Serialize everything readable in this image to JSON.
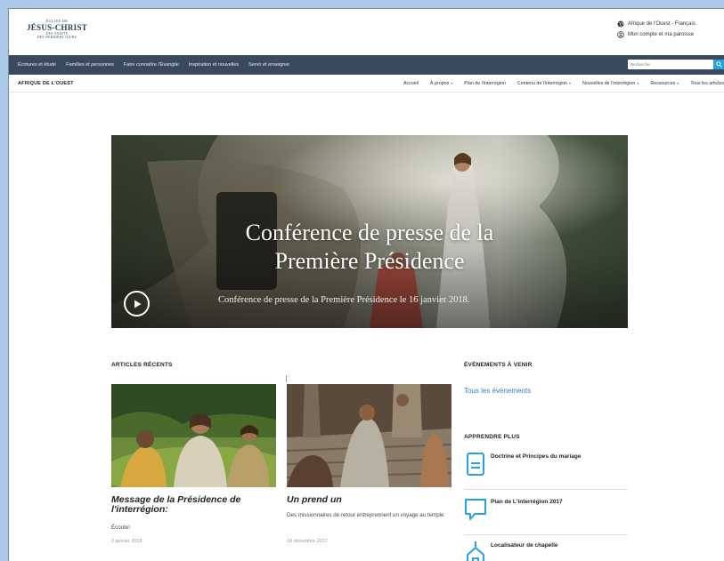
{
  "header": {
    "logo": {
      "line1": "ÉGLISE DE",
      "line2": "JÉSUS-CHRIST",
      "line3": "DES SAINTS",
      "line4": "DES DERNIERS JOURS"
    },
    "region_language": "Afrique de l'Ouest - Français",
    "account": "Mon compte et ma paroisse"
  },
  "main_nav": {
    "items": [
      "Écritures et étude",
      "Familles et personnes",
      "Faire connaître l'Évangile",
      "Inspiration et nouvelles",
      "Servir et enseigner"
    ],
    "search_placeholder": "Recherche"
  },
  "sub_nav": {
    "region": "AFRIQUE DE L'OUEST",
    "links": [
      {
        "label": "Accueil",
        "dropdown": false
      },
      {
        "label": "À propos",
        "dropdown": true
      },
      {
        "label": "Plan de l'interrégion",
        "dropdown": false
      },
      {
        "label": "Contenu de l'interrégion",
        "dropdown": true
      },
      {
        "label": "Nouvelles de l'interrégion",
        "dropdown": true
      },
      {
        "label": "Ressources",
        "dropdown": true
      },
      {
        "label": "Tous les articles",
        "dropdown": false
      }
    ]
  },
  "hero": {
    "title": "Conférence de presse de la Première Présidence",
    "subtitle": "Conférence de presse de la Première Présidence le 16 janvier 2018."
  },
  "articles": {
    "section_title": "ARTICLES RÉCENTS",
    "items": [
      {
        "title": "Message de la Présidence de l'interrégion:",
        "desc": "Écoute!",
        "date": "2 janvier 2018"
      },
      {
        "title": "Un prend un",
        "desc": "Des missionnaires de retour entreprennent un voyage au temple",
        "date": "18 décembre 2017"
      }
    ]
  },
  "events": {
    "section_title": "ÉVÈNEMENTS À VENIR",
    "link": "Tous les évènements"
  },
  "learn_more": {
    "section_title": "APPRENDRE PLUS",
    "items": [
      {
        "label": "Doctrine et Principes du mariage",
        "icon": "book-icon"
      },
      {
        "label": "Plan de L'interrégion 2017",
        "icon": "chat-bubble-icon"
      },
      {
        "label": "Localisateur de chapelle",
        "icon": "chapel-icon"
      }
    ]
  },
  "colors": {
    "nav_bg": "#3a4a5e",
    "accent": "#29a3e0",
    "link": "#3d7fbd",
    "backdrop": "#a9c9e6"
  }
}
